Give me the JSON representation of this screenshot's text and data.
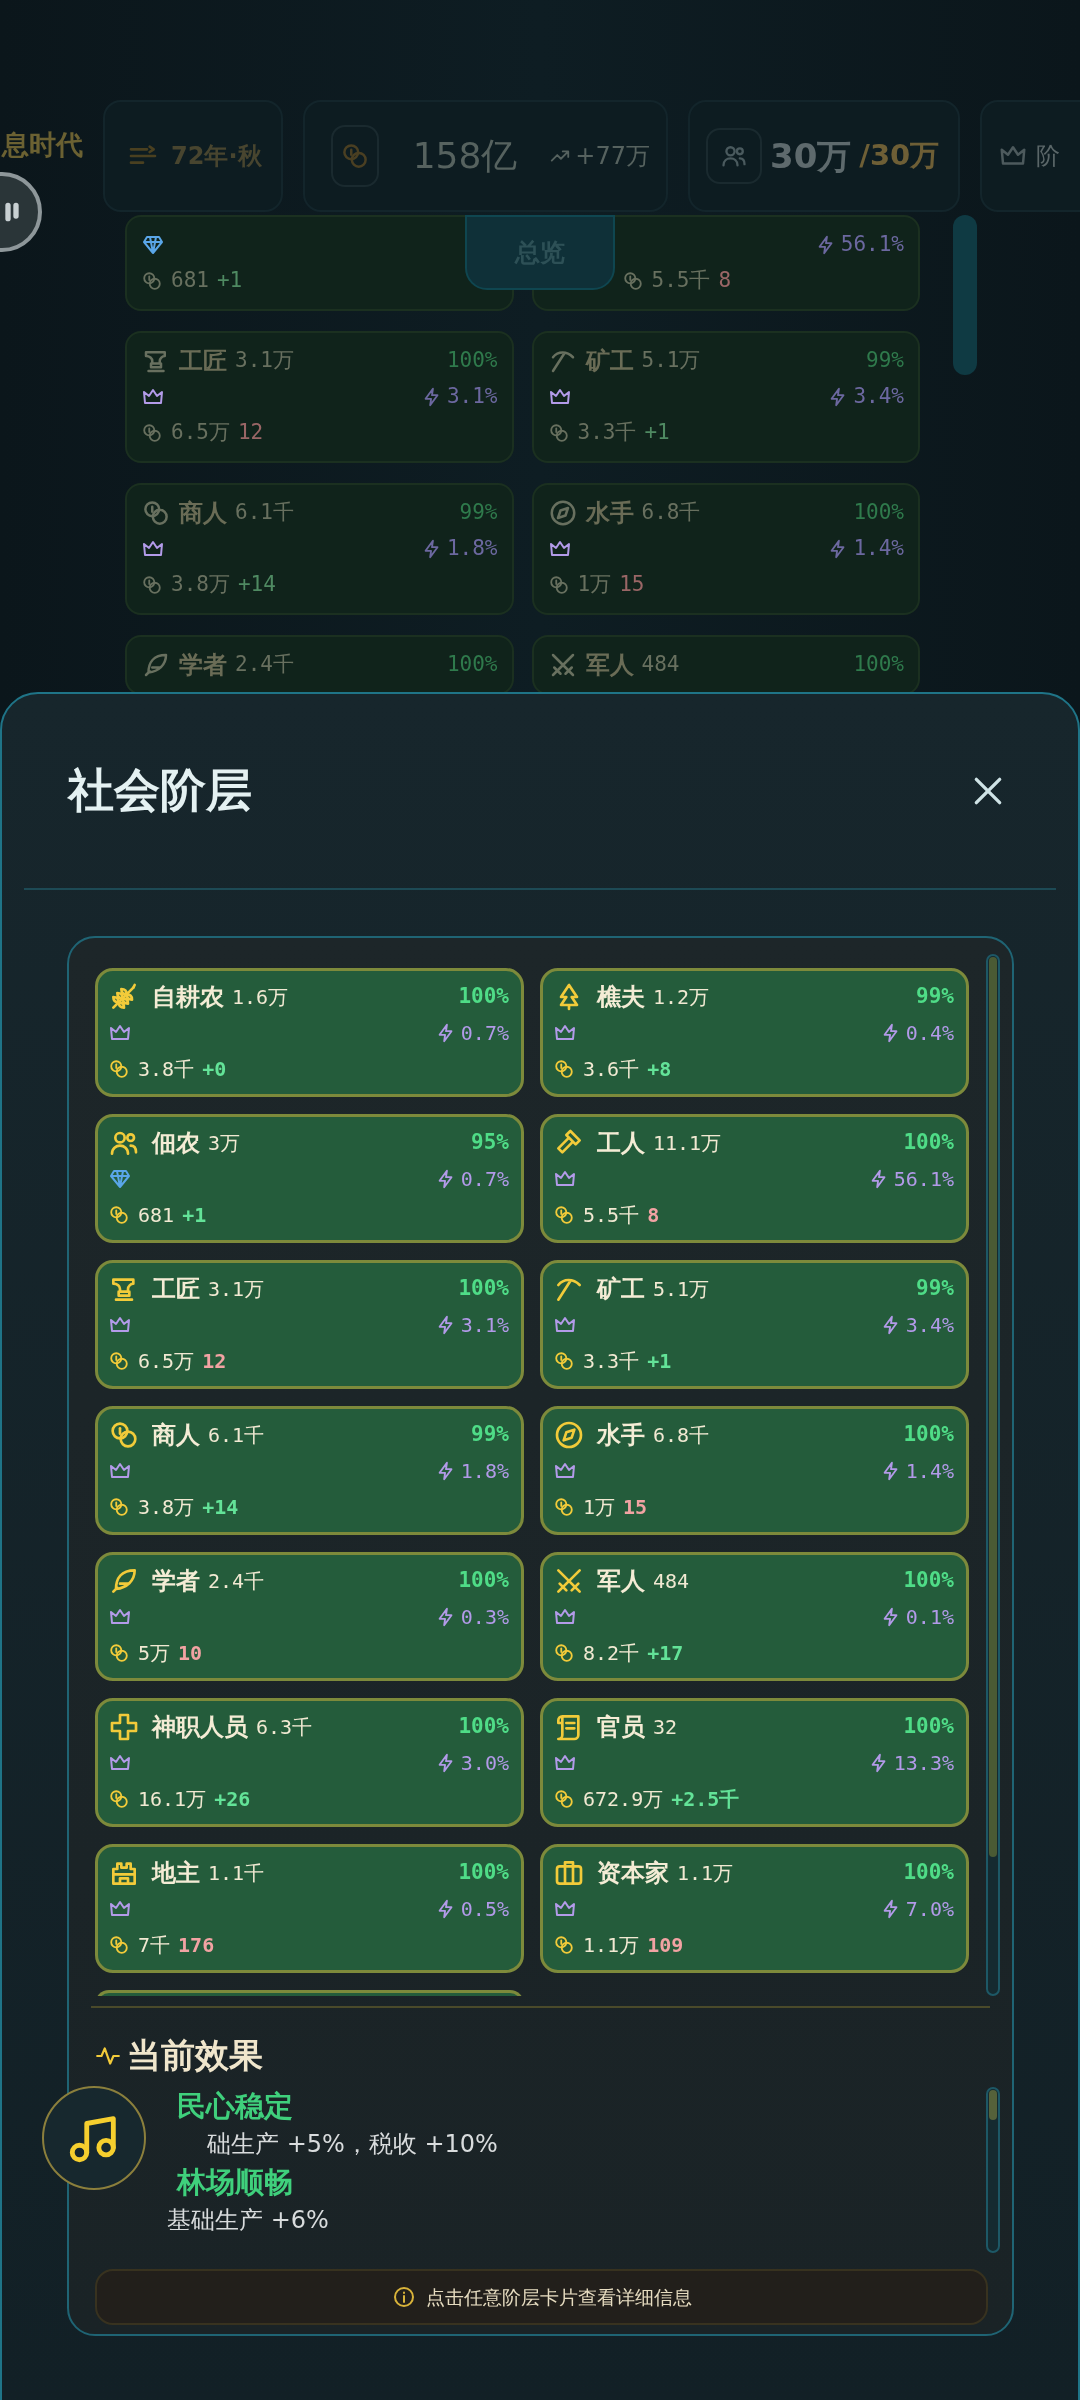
{
  "topbar": {
    "era": "息时代",
    "date": "72年·秋",
    "gold": "158亿",
    "gold_trend": "+77万",
    "population": "30万",
    "population_max": "/30万",
    "rank": "阶"
  },
  "overview_tab": "总览",
  "background_classes": [
    {
      "kind": "gem",
      "wealth": "681",
      "change": "+1",
      "positive": true
    },
    {
      "kind": "none",
      "share": "56.1%",
      "wealth": "5.5千",
      "change": "8",
      "positive": false
    },
    {
      "kind": "crown",
      "name": "工匠",
      "pop": "3.1万",
      "approval": "100%",
      "share": "3.1%",
      "wealth": "6.5万",
      "change": "12",
      "positive": false
    },
    {
      "kind": "crown",
      "name": "矿工",
      "pop": "5.1万",
      "approval": "99%",
      "share": "3.4%",
      "wealth": "3.3千",
      "change": "+1",
      "positive": true
    },
    {
      "kind": "crown",
      "name": "商人",
      "pop": "6.1千",
      "approval": "99%",
      "share": "1.8%",
      "wealth": "3.8万",
      "change": "+14",
      "positive": true
    },
    {
      "kind": "crown",
      "name": "水手",
      "pop": "6.8千",
      "approval": "100%",
      "share": "1.4%",
      "wealth": "1万",
      "change": "15",
      "positive": false
    },
    {
      "kind": "none",
      "name": "学者",
      "pop": "2.4千",
      "approval": "100%"
    },
    {
      "kind": "none",
      "name": "军人",
      "pop": "484",
      "approval": "100%"
    }
  ],
  "modal": {
    "title": "社会阶层",
    "classes": [
      {
        "name": "自耕农",
        "pop": "1.6万",
        "approval": "100%",
        "kind": "crown",
        "share": "0.7%",
        "wealth": "3.8千",
        "change": "+0",
        "positive": true
      },
      {
        "name": "樵夫",
        "pop": "1.2万",
        "approval": "99%",
        "kind": "crown",
        "share": "0.4%",
        "wealth": "3.6千",
        "change": "+8",
        "positive": true
      },
      {
        "name": "佃农",
        "pop": "3万",
        "approval": "95%",
        "kind": "gem",
        "share": "0.7%",
        "wealth": "681",
        "change": "+1",
        "positive": true
      },
      {
        "name": "工人",
        "pop": "11.1万",
        "approval": "100%",
        "kind": "crown",
        "share": "56.1%",
        "wealth": "5.5千",
        "change": "8",
        "positive": false
      },
      {
        "name": "工匠",
        "pop": "3.1万",
        "approval": "100%",
        "kind": "crown",
        "share": "3.1%",
        "wealth": "6.5万",
        "change": "12",
        "positive": false
      },
      {
        "name": "矿工",
        "pop": "5.1万",
        "approval": "99%",
        "kind": "crown",
        "share": "3.4%",
        "wealth": "3.3千",
        "change": "+1",
        "positive": true
      },
      {
        "name": "商人",
        "pop": "6.1千",
        "approval": "99%",
        "kind": "crown",
        "share": "1.8%",
        "wealth": "3.8万",
        "change": "+14",
        "positive": true
      },
      {
        "name": "水手",
        "pop": "6.8千",
        "approval": "100%",
        "kind": "crown",
        "share": "1.4%",
        "wealth": "1万",
        "change": "15",
        "positive": false
      },
      {
        "name": "学者",
        "pop": "2.4千",
        "approval": "100%",
        "kind": "crown",
        "share": "0.3%",
        "wealth": "5万",
        "change": "10",
        "positive": false
      },
      {
        "name": "军人",
        "pop": "484",
        "approval": "100%",
        "kind": "crown",
        "share": "0.1%",
        "wealth": "8.2千",
        "change": "+17",
        "positive": true
      },
      {
        "name": "神职人员",
        "pop": "6.3千",
        "approval": "100%",
        "kind": "crown",
        "share": "3.0%",
        "wealth": "16.1万",
        "change": "+26",
        "positive": true
      },
      {
        "name": "官员",
        "pop": "32",
        "approval": "100%",
        "kind": "crown",
        "share": "13.3%",
        "wealth": "672.9万",
        "change": "+2.5千",
        "positive": true
      },
      {
        "name": "地主",
        "pop": "1.1千",
        "approval": "100%",
        "kind": "crown",
        "share": "0.5%",
        "wealth": "7千",
        "change": "176",
        "positive": false
      },
      {
        "name": "资本家",
        "pop": "1.1万",
        "approval": "100%",
        "kind": "crown",
        "share": "7.0%",
        "wealth": "1.1万",
        "change": "109",
        "positive": false
      }
    ],
    "effects_title": "当前效果",
    "effects": [
      {
        "name": "民心稳定",
        "desc": "础生产 +5%，税收 +10%"
      },
      {
        "name": "林场顺畅",
        "desc": "基础生产 +6%"
      }
    ],
    "hint": "点击任意阶层卡片查看详细信息"
  }
}
